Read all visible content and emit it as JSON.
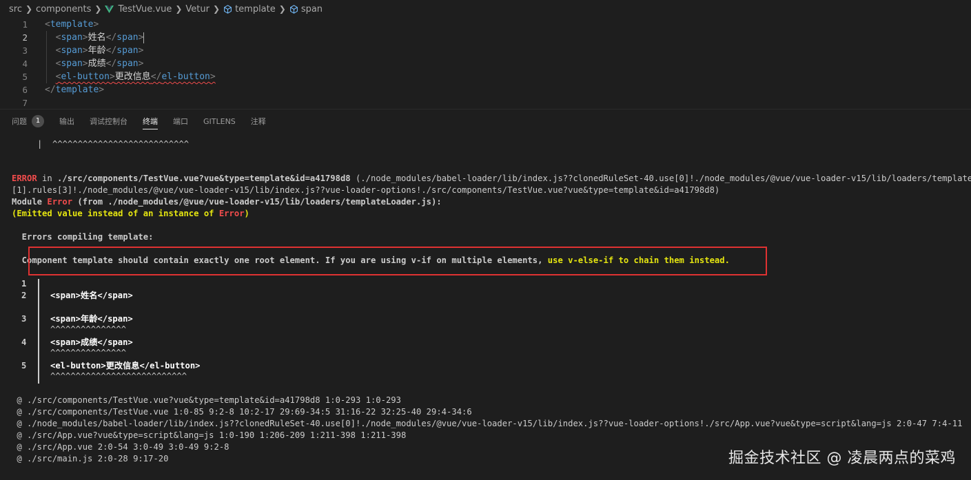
{
  "breadcrumb": {
    "items": [
      "src",
      "components",
      "TestVue.vue",
      "Vetur",
      "template",
      "span"
    ],
    "separator": ">"
  },
  "editor": {
    "line_numbers": [
      "1",
      "2",
      "3",
      "4",
      "5",
      "6",
      "7"
    ],
    "lines": [
      {
        "open": "template",
        "text": "",
        "close": ""
      },
      {
        "open": "span",
        "text": "姓名",
        "close": "span"
      },
      {
        "open": "span",
        "text": "年龄",
        "close": "span"
      },
      {
        "open": "span",
        "text": "成绩",
        "close": "span"
      },
      {
        "open": "el-button",
        "text": "更改信息",
        "close": "el-button"
      },
      {
        "open": "",
        "text": "",
        "close": "template"
      }
    ]
  },
  "panel": {
    "tabs": [
      "问题",
      "输出",
      "调试控制台",
      "终端",
      "端口",
      "GITLENS",
      "注释"
    ],
    "problems_count": "1",
    "active_tab": "终端"
  },
  "terminal": {
    "top_carets": "|  ^^^^^^^^^^^^^^^^^^^^^^^^^^^",
    "error_label": "ERROR",
    "error_in": " in ",
    "error_file": "./src/components/TestVue.vue?vue&type=template&id=a41798d8",
    "error_rest1": " (./node_modules/babel-loader/lib/index.js??clonedRuleSet-40.use[0]!./node_modules/@vue/vue-loader-v15/lib/loaders/templateLoader.js??ruleSet",
    "error_rest2": "[1].rules[3]!./node_modules/@vue/vue-loader-v15/lib/index.js??vue-loader-options!./src/components/TestVue.vue?vue&type=template&id=a41798d8)",
    "module_label": "Module ",
    "module_error": "Error",
    "module_rest": " (from ./node_modules/@vue/vue-loader-v15/lib/loaders/templateLoader.js):",
    "emitted_1": "(Emitted value instead of an instance of ",
    "emitted_error": "Error",
    "emitted_2": ")",
    "errors_compiling": "  Errors compiling template:",
    "component_msg_1": "  Component template should contain exactly one root element. If you are using v-if on multiple elements, ",
    "component_msg_2": "use v-else-if to chain them instead.",
    "snippet": [
      {
        "num": "1",
        "code": ""
      },
      {
        "num": "2",
        "code": "<span>姓名</span>"
      },
      {
        "num": "3",
        "code": "<span>年龄</span>"
      },
      {
        "num": "4",
        "code": "<span>成绩</span>"
      },
      {
        "num": "5",
        "code": "<el-button>更改信息</el-button>"
      }
    ],
    "caret_short": "^^^^^^^^^^^^^^^",
    "caret_long": "^^^^^^^^^^^^^^^^^^^^^^^^^^^",
    "at_lines": [
      " @ ./src/components/TestVue.vue?vue&type=template&id=a41798d8 1:0-293 1:0-293",
      " @ ./src/components/TestVue.vue 1:0-85 9:2-8 10:2-17 29:69-34:5 31:16-22 32:25-40 29:4-34:6",
      " @ ./node_modules/babel-loader/lib/index.js??clonedRuleSet-40.use[0]!./node_modules/@vue/vue-loader-v15/lib/index.js??vue-loader-options!./src/App.vue?vue&type=script&lang=js 2:0-47 7:4-11",
      " @ ./src/App.vue?vue&type=script&lang=js 1:0-190 1:206-209 1:211-398 1:211-398",
      " @ ./src/App.vue 2:0-54 3:0-49 3:0-49 9:2-8",
      " @ ./src/main.js 2:0-28 9:17-20"
    ]
  },
  "watermark": "掘金技术社区 @ 凌晨两点的菜鸡",
  "colors": {
    "background": "#1e1e1e",
    "tag": "#569cd6",
    "error_red": "#f14c4c",
    "warning_yellow": "#e5e510",
    "highlight_box": "#e03232"
  }
}
